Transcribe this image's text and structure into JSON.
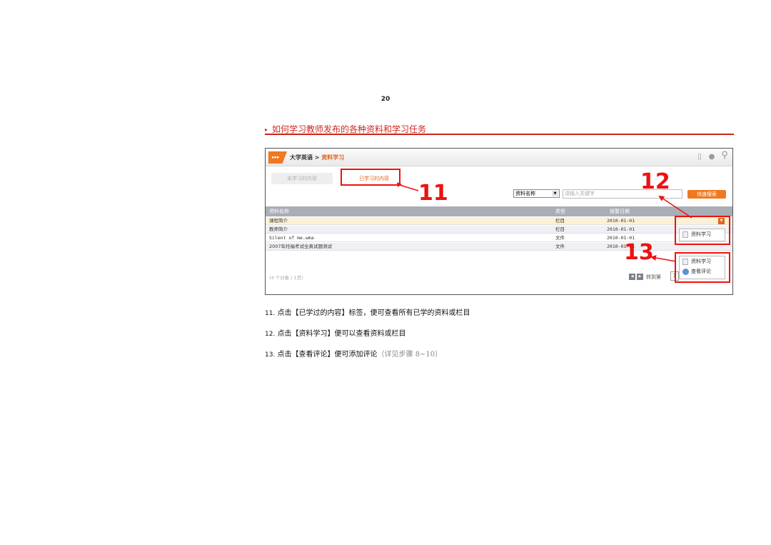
{
  "page_number": "20",
  "section_title": "如何学习教师发布的各种资料和学习任务",
  "screenshot": {
    "breadcrumb": {
      "root": "大学英语",
      "sep": ">",
      "current": "资料学习"
    },
    "tabs": [
      {
        "label": "未学习的内容"
      },
      {
        "label": "已学习的内容"
      }
    ],
    "search": {
      "field": "资料名称",
      "placeholder": "请输入关键字",
      "button": "快速搜索"
    },
    "table": {
      "headers": [
        "资料名称",
        "类型",
        "报警日期"
      ],
      "rows": [
        {
          "name": "课程简介",
          "type": "栏目",
          "date": "2010-01-01"
        },
        {
          "name": "教师简介",
          "type": "栏目",
          "date": "2010-01-01"
        },
        {
          "name": "Silent of me.wma",
          "type": "文件",
          "date": "2010-01-01"
        },
        {
          "name": "2007年托福考试全真试题测试",
          "type": "文件",
          "date": "2010-01-01"
        }
      ]
    },
    "footer": {
      "count": "(4 个对象 / 1页)",
      "jump": "转到第",
      "page_value": "1"
    },
    "menu1": [
      "资料学习"
    ],
    "menu2": [
      "资料学习",
      "查看评论"
    ]
  },
  "callouts": [
    "11",
    "12",
    "13"
  ],
  "steps": [
    {
      "num": "11.",
      "text": "点击【已学过的内容】标签，便可查看所有已学的资料或栏目",
      "note": ""
    },
    {
      "num": "12.",
      "text": "点击【资料学习】便可以查看资料或栏目",
      "note": ""
    },
    {
      "num": "13.",
      "text": "点击【查看评论】便可添加评论",
      "note": "（详见步骤 8~10）"
    }
  ],
  "colors": {
    "accent_red": "#e11111",
    "orange": "#f07820",
    "title_red": "#d0281e"
  },
  "icons": [
    "home-icon",
    "document-icon",
    "comment-icon",
    "search-icon",
    "dropdown-arrow-icon",
    "prev-page-icon",
    "next-page-icon",
    "eye-icon"
  ]
}
